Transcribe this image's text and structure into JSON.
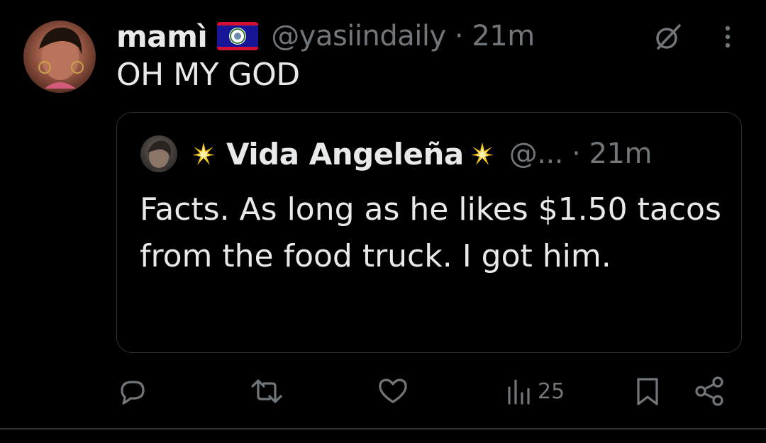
{
  "post": {
    "display_name": "mamì",
    "flag_icon": "belize-flag-icon",
    "handle_time": "@yasiindaily · 21m",
    "text": "OH MY GOD"
  },
  "quoted_post": {
    "display_name": "Vida Angeleña",
    "decoration_icon": "sparkle-icon",
    "handle_time": "@... · 21m",
    "text": "Facts. As long as he likes $1.50 tacos from the food truck. I got him."
  },
  "actions": {
    "views_count": "25"
  },
  "colors": {
    "background": "#000000",
    "primary_text": "#e7e9ea",
    "secondary_text": "#71767b",
    "border": "#2f3336",
    "sparkle": "#f5c518"
  }
}
